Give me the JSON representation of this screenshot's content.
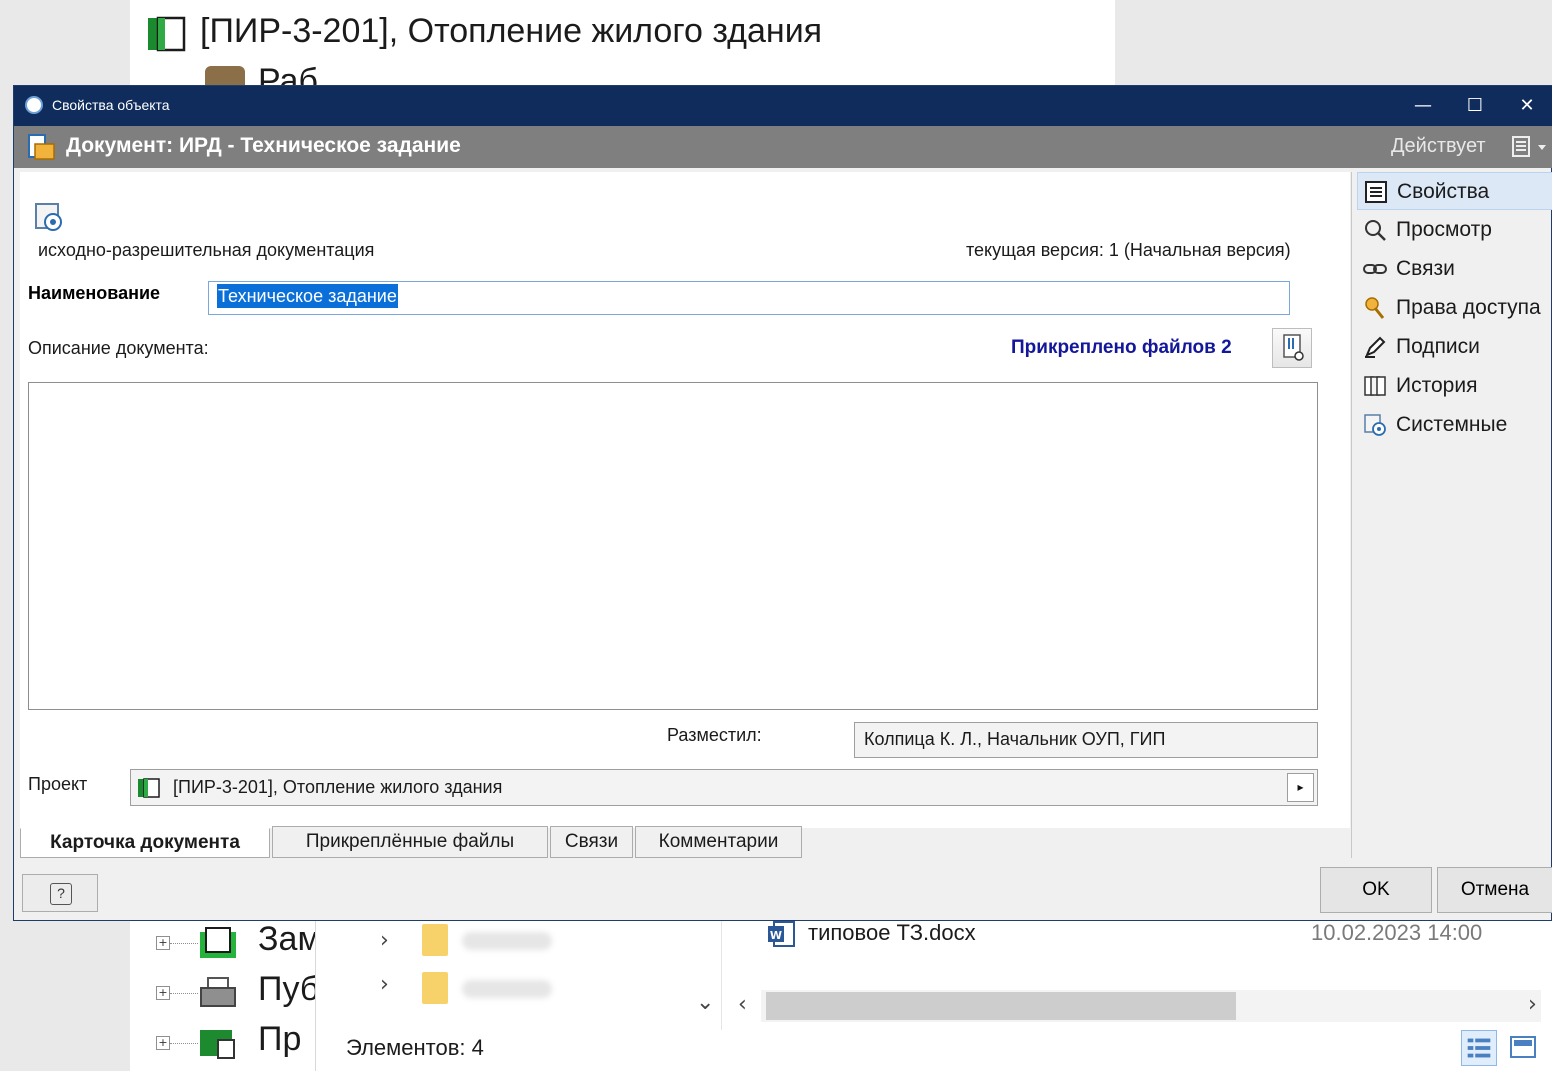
{
  "background": {
    "tree_top_title": "[ПИР-3-201], Отопление жилого здания",
    "tree_top_sub": "Раб",
    "tree_lower_items": [
      "Зам",
      "Пуб",
      "Пр"
    ],
    "explorer_file_name": "типовое ТЗ.docx",
    "explorer_file_date": "10.02.2023 14:00",
    "explorer_status": "Элементов: 4"
  },
  "window": {
    "title": "Свойства объекта",
    "minimize": "—",
    "maximize": "☐",
    "close": "✕"
  },
  "header": {
    "title": "Документ: ИРД - Техническое задание",
    "status": "Действует",
    "menu_icon": "document-menu-icon"
  },
  "form": {
    "doc_type": "исходно-разрешительная документация",
    "version": "текущая версия: 1 (Начальная версия)",
    "name_label": "Наименование",
    "name_value": "Техническое задание",
    "desc_label": "Описание документа:",
    "attached_label": "Прикреплено файлов 2",
    "desc_value": "",
    "posted_label": "Разместил:",
    "posted_value": "Колпица К. Л., Начальник ОУП, ГИП",
    "project_label": "Проект",
    "project_value": "[ПИР-3-201], Отопление жилого здания",
    "project_arrow": "▸"
  },
  "tabs": [
    {
      "label": "Карточка документа",
      "active": true
    },
    {
      "label": "Прикреплённые файлы",
      "active": false
    },
    {
      "label": "Связи",
      "active": false
    },
    {
      "label": "Комментарии",
      "active": false
    }
  ],
  "sidebar": {
    "items": [
      {
        "label": "Свойства",
        "icon": "properties-icon",
        "selected": true
      },
      {
        "label": "Просмотр",
        "icon": "magnifier-icon",
        "selected": false
      },
      {
        "label": "Связи",
        "icon": "link-icon",
        "selected": false
      },
      {
        "label": "Права доступа",
        "icon": "key-icon",
        "selected": false
      },
      {
        "label": "Подписи",
        "icon": "pen-icon",
        "selected": false
      },
      {
        "label": "История",
        "icon": "history-icon",
        "selected": false
      },
      {
        "label": "Системные",
        "icon": "system-icon",
        "selected": false
      }
    ]
  },
  "buttons": {
    "help": "?",
    "ok": "OK",
    "cancel": "Отмена"
  },
  "colors": {
    "titlebar": "#0f2c5c",
    "header": "#7f7f7f",
    "selection": "#0a6fd8",
    "attached_link": "#13179a"
  }
}
